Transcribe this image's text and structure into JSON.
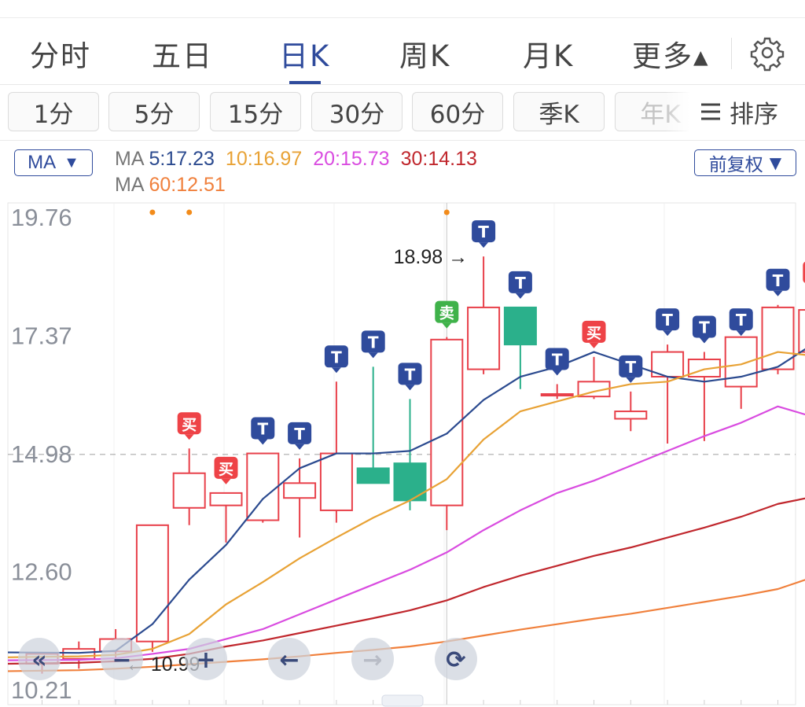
{
  "tabs": [
    {
      "label": "分时",
      "active": false
    },
    {
      "label": "五日",
      "active": false
    },
    {
      "label": "日K",
      "active": true
    },
    {
      "label": "周K",
      "active": false
    },
    {
      "label": "月K",
      "active": false
    },
    {
      "label": "更多▴",
      "active": false
    }
  ],
  "settings_icon": "gear-icon",
  "minute_buttons": [
    "1分",
    "5分",
    "15分",
    "30分",
    "60分",
    "季K",
    "年K"
  ],
  "sort_label": "排序",
  "sort_icon": "menu-icon",
  "ma_dropdown": {
    "label": "MA",
    "arrow": "▼"
  },
  "fq_dropdown": {
    "label": "前复权",
    "arrow": "▼"
  },
  "ma_legend": [
    {
      "prefix": "MA",
      "key": "5",
      "value": "17.23",
      "text": "5:17.23",
      "color": "#2b4a8f"
    },
    {
      "key": "10",
      "value": "16.97",
      "text": "10:16.97",
      "color": "#e8a235"
    },
    {
      "key": "20",
      "value": "15.73",
      "text": "20:15.73",
      "color": "#d94ce0"
    },
    {
      "key": "30",
      "value": "14.13",
      "text": "30:14.13",
      "color": "#c0272d"
    },
    {
      "prefix": "MA",
      "key": "60",
      "value": "12.51",
      "text": "60:12.51",
      "color": "#f0803c"
    }
  ],
  "colors": {
    "up": "#e8404a",
    "down": "#2bb08b",
    "accent": "#2f4b9c",
    "tag_t": "#2f4b9c",
    "tag_buy": "#ee4347",
    "tag_sell": "#3fb24a"
  },
  "chart_data": {
    "type": "candlestick",
    "y_ticks": [
      "19.76",
      "17.37",
      "14.98",
      "12.60",
      "10.21"
    ],
    "ylim": [
      10.21,
      19.76
    ],
    "reference_line": 14.98,
    "max_label": "18.98",
    "min_label": "10.99",
    "candles": [
      {
        "o": 10.75,
        "h": 10.85,
        "l": 10.55,
        "c": 10.95
      },
      {
        "o": 10.85,
        "h": 11.2,
        "l": 10.65,
        "c": 11.05
      },
      {
        "o": 11.0,
        "h": 11.45,
        "l": 10.8,
        "c": 11.25
      },
      {
        "o": 11.2,
        "h": 13.55,
        "l": 10.99,
        "c": 13.55
      },
      {
        "o": 13.9,
        "h": 15.1,
        "l": 13.55,
        "c": 14.6
      },
      {
        "o": 13.95,
        "h": 14.2,
        "l": 13.2,
        "c": 14.2
      },
      {
        "o": 13.65,
        "h": 15.0,
        "l": 13.6,
        "c": 15.0
      },
      {
        "o": 14.1,
        "h": 14.9,
        "l": 13.3,
        "c": 14.4
      },
      {
        "o": 13.85,
        "h": 16.45,
        "l": 13.6,
        "c": 15.0
      },
      {
        "o": 14.7,
        "h": 16.75,
        "l": 14.6,
        "c": 14.4
      },
      {
        "o": 14.8,
        "h": 16.1,
        "l": 13.85,
        "c": 14.05
      },
      {
        "o": 13.95,
        "h": 17.35,
        "l": 13.45,
        "c": 17.3
      },
      {
        "o": 16.7,
        "h": 18.98,
        "l": 16.6,
        "c": 17.95
      },
      {
        "o": 17.95,
        "h": 17.95,
        "l": 16.3,
        "c": 17.2
      },
      {
        "o": 16.2,
        "h": 16.4,
        "l": 16.1,
        "c": 16.2
      },
      {
        "o": 16.15,
        "h": 16.95,
        "l": 16.1,
        "c": 16.45
      },
      {
        "o": 15.7,
        "h": 16.25,
        "l": 15.45,
        "c": 15.85
      },
      {
        "o": 16.55,
        "h": 17.2,
        "l": 15.2,
        "c": 17.05
      },
      {
        "o": 16.55,
        "h": 17.05,
        "l": 15.25,
        "c": 16.9
      },
      {
        "o": 16.35,
        "h": 17.2,
        "l": 15.9,
        "c": 17.35
      },
      {
        "o": 16.7,
        "h": 18.0,
        "l": 16.6,
        "c": 17.95
      },
      {
        "o": 17.05,
        "h": 18.15,
        "l": 16.7,
        "c": 17.9
      }
    ],
    "ma_series": [
      {
        "key": "MA5",
        "color": "#2b4a8f",
        "values": [
          10.98,
          10.97,
          11.01,
          11.55,
          12.45,
          13.15,
          14.08,
          14.7,
          15.0,
          15.0,
          15.05,
          15.4,
          16.08,
          16.55,
          16.75,
          17.05,
          16.8,
          16.55,
          16.45,
          16.55,
          16.75,
          17.23
        ]
      },
      {
        "key": "MA10",
        "color": "#e8a235",
        "values": [
          10.88,
          10.9,
          10.93,
          11.05,
          11.35,
          11.95,
          12.4,
          12.88,
          13.3,
          13.7,
          14.05,
          14.48,
          15.28,
          15.85,
          16.05,
          16.25,
          16.4,
          16.45,
          16.7,
          16.8,
          17.05,
          16.97
        ]
      },
      {
        "key": "MA20",
        "color": "#d94ce0",
        "values": [
          10.82,
          10.83,
          10.86,
          10.95,
          11.05,
          11.25,
          11.45,
          11.75,
          12.05,
          12.35,
          12.65,
          13.0,
          13.45,
          13.85,
          14.2,
          14.45,
          14.75,
          15.05,
          15.35,
          15.62,
          15.95,
          15.73
        ]
      },
      {
        "key": "MA30",
        "color": "#c0272d",
        "values": [
          10.75,
          10.77,
          10.8,
          10.85,
          10.95,
          11.1,
          11.22,
          11.37,
          11.52,
          11.67,
          11.83,
          12.03,
          12.3,
          12.53,
          12.73,
          12.93,
          13.1,
          13.3,
          13.5,
          13.72,
          13.98,
          14.13
        ]
      },
      {
        "key": "MA60",
        "color": "#f0803c",
        "values": [
          10.6,
          10.62,
          10.65,
          10.69,
          10.74,
          10.79,
          10.84,
          10.9,
          10.97,
          11.03,
          11.1,
          11.2,
          11.32,
          11.44,
          11.55,
          11.66,
          11.76,
          11.88,
          12.0,
          12.12,
          12.26,
          12.51
        ]
      }
    ],
    "markers": [
      {
        "index": 4,
        "label": "买",
        "kind": "buy"
      },
      {
        "index": 5,
        "label": "买",
        "kind": "buy"
      },
      {
        "index": 6,
        "label": "T",
        "kind": "t"
      },
      {
        "index": 7,
        "label": "T",
        "kind": "t"
      },
      {
        "index": 8,
        "label": "T",
        "kind": "t"
      },
      {
        "index": 9,
        "label": "T",
        "kind": "t"
      },
      {
        "index": 10,
        "label": "T",
        "kind": "t"
      },
      {
        "index": 11,
        "label": "卖",
        "kind": "sell"
      },
      {
        "index": 12,
        "label": "T",
        "kind": "t"
      },
      {
        "index": 13,
        "label": "T",
        "kind": "t"
      },
      {
        "index": 14,
        "label": "T",
        "kind": "t"
      },
      {
        "index": 15,
        "label": "买",
        "kind": "buy"
      },
      {
        "index": 16,
        "label": "T",
        "kind": "t"
      },
      {
        "index": 17,
        "label": "T",
        "kind": "t"
      },
      {
        "index": 18,
        "label": "T",
        "kind": "t"
      },
      {
        "index": 19,
        "label": "T",
        "kind": "t"
      },
      {
        "index": 20,
        "label": "T",
        "kind": "t"
      },
      {
        "index": 21,
        "label": "买",
        "kind": "buy"
      }
    ],
    "event_dots": [
      3,
      4,
      11
    ],
    "crosshair_index": 11,
    "grid": true
  },
  "controls": [
    {
      "name": "rewind-button",
      "icon": "double-chevron-left-icon",
      "symbol": "«"
    },
    {
      "name": "zoom-out-button",
      "icon": "minus-icon",
      "symbol": "−"
    },
    {
      "name": "zoom-in-button",
      "icon": "plus-icon",
      "symbol": "+"
    },
    {
      "name": "left-button",
      "icon": "arrow-left-icon",
      "symbol": "←"
    },
    {
      "name": "right-button",
      "icon": "arrow-right-icon",
      "symbol": "→"
    },
    {
      "name": "rotate-button",
      "icon": "rotate-icon",
      "symbol": "⟳"
    }
  ]
}
